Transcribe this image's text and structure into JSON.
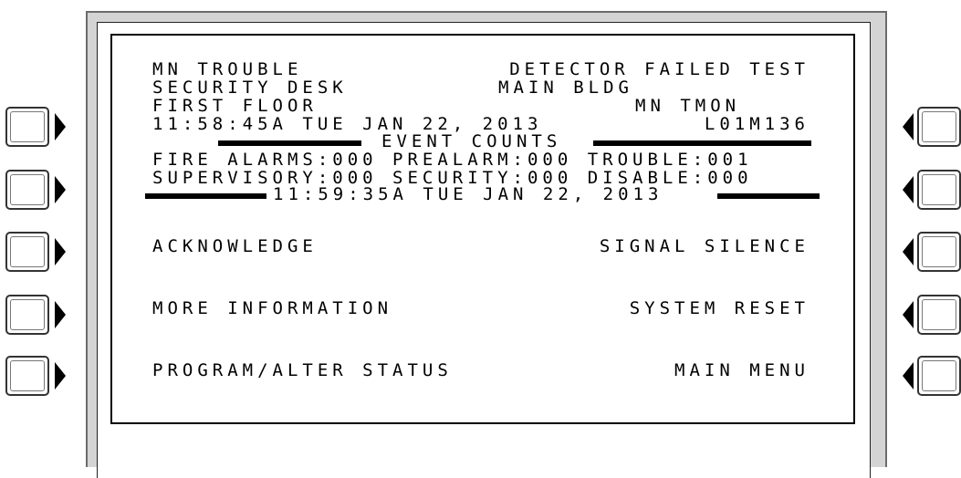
{
  "event": {
    "type": "MN TROUBLE",
    "description": "DETECTOR FAILED TEST",
    "location1": "SECURITY DESK",
    "location2": "MAIN BLDG",
    "location3": "FIRST FLOOR",
    "device_type": "MN TMON",
    "timestamp": "11:58:45A TUE JAN 22, 2013",
    "address": "L01M136"
  },
  "event_counts": {
    "header": "EVENT COUNTS",
    "line1": "FIRE ALARMS:000 PREALARM:000 TROUBLE:001",
    "line2": "SUPERVISORY:000 SECURITY:000 DISABLE:000"
  },
  "clock": "11:59:35A TUE JAN 22, 2013",
  "soft_keys": {
    "left": [
      "ACKNOWLEDGE",
      "MORE INFORMATION",
      "PROGRAM/ALTER STATUS"
    ],
    "right": [
      "SIGNAL SILENCE",
      "SYSTEM RESET",
      "MAIN MENU"
    ]
  }
}
